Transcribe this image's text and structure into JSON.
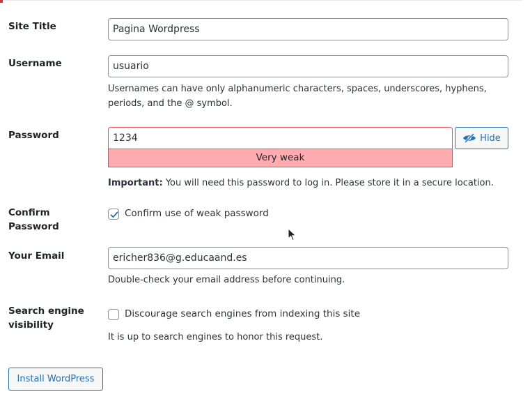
{
  "form": {
    "site_title": {
      "label": "Site Title",
      "value": "Pagina Wordpress"
    },
    "username": {
      "label": "Username",
      "value": "usuario",
      "description": "Usernames can have only alphanumeric characters, spaces, underscores, hyphens, periods, and the @ symbol."
    },
    "password": {
      "label": "Password",
      "value": "1234",
      "hide_label": "Hide",
      "hide_icon": "eye-slash-icon",
      "strength": "Very weak",
      "notice_strong": "Important:",
      "notice_rest": " You will need this password to log in. Please store it in a secure location."
    },
    "confirm_password": {
      "label_line1": "Confirm",
      "label_line2": "Password",
      "checkbox_label": "Confirm use of weak password",
      "checked": true
    },
    "email": {
      "label": "Your Email",
      "value": "ericher836@g.educaand.es",
      "description": "Double-check your email address before continuing."
    },
    "search_engine": {
      "label_line1": "Search engine",
      "label_line2": "visibility",
      "checkbox_label": "Discourage search engines from indexing this site",
      "checked": false,
      "description": "It is up to search engines to honor this request."
    },
    "install_button": "Install WordPress"
  },
  "colors": {
    "accent": "#2271b1",
    "strength_bg": "#ffabaf",
    "strength_border": "#e65054",
    "text": "#1d2327"
  }
}
